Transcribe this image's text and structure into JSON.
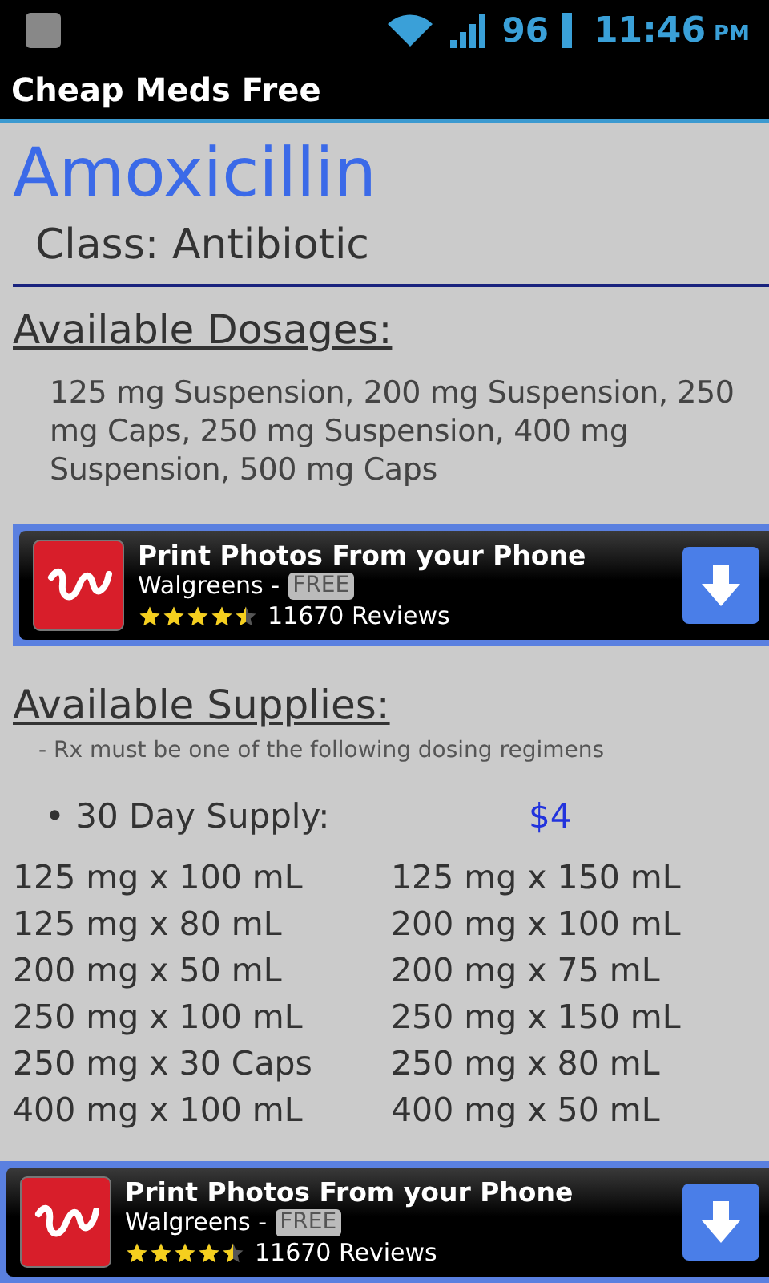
{
  "status_bar": {
    "battery": "96",
    "time": "11:46",
    "ampm": "PM"
  },
  "app_bar": {
    "title": "Cheap Meds Free"
  },
  "drug": {
    "name": "Amoxicillin",
    "class_label": "Class:",
    "class_value": "Antibiotic"
  },
  "dosages": {
    "heading": "Available Dosages:",
    "text": "125 mg Suspension, 200 mg Suspension, 250 mg Caps, 250 mg Suspension, 400 mg Suspension, 500 mg Caps"
  },
  "ads": [
    {
      "title": "Print Photos From your Phone",
      "publisher": "Walgreens -",
      "price": "FREE",
      "stars": 4.5,
      "reviews": "11670 Reviews"
    },
    {
      "title": "Print Photos From your Phone",
      "publisher": "Walgreens -",
      "price": "FREE",
      "stars": 4.5,
      "reviews": "11670 Reviews"
    }
  ],
  "supplies": {
    "heading": "Available Supplies:",
    "note": "- Rx must be one of the following dosing regimens",
    "bullet": "•",
    "period": "30 Day Supply:",
    "price": "$4",
    "regimens": [
      "125 mg x 100 mL",
      "125 mg x 150 mL",
      "125 mg x 80 mL",
      "200 mg x 100 mL",
      "200 mg x 50 mL",
      "200 mg x 75 mL",
      "250 mg x 100 mL",
      "250 mg x 150 mL",
      "250 mg x 30 Caps",
      "250 mg x 80 mL",
      "400 mg x 100 mL",
      "400 mg x 50 mL"
    ]
  }
}
